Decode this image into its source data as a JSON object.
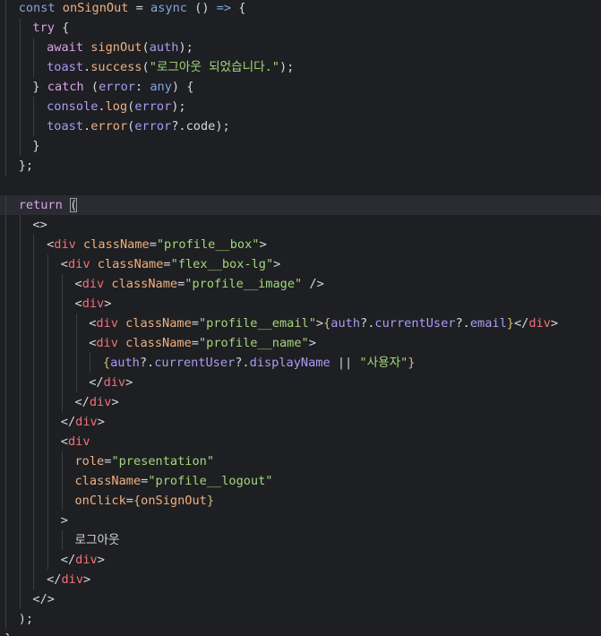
{
  "editor": {
    "language": "tsx",
    "theme_background": "#1e1f22",
    "lines": [
      {
        "indent": 1,
        "tokens": [
          [
            "kw",
            "const "
          ],
          [
            "fn",
            "onSignOut"
          ],
          [
            "pn",
            " = "
          ],
          [
            "kw",
            "async"
          ],
          [
            "pn",
            " () "
          ],
          [
            "kw",
            "=>"
          ],
          [
            "pn",
            " {"
          ]
        ]
      },
      {
        "indent": 2,
        "tokens": [
          [
            "ctl",
            "try"
          ],
          [
            "pn",
            " {"
          ]
        ]
      },
      {
        "indent": 3,
        "tokens": [
          [
            "ctl",
            "await "
          ],
          [
            "fn",
            "signOut"
          ],
          [
            "pn",
            "("
          ],
          [
            "var",
            "auth"
          ],
          [
            "pn",
            ");"
          ]
        ]
      },
      {
        "indent": 3,
        "tokens": [
          [
            "var",
            "toast"
          ],
          [
            "pn",
            "."
          ],
          [
            "fn",
            "success"
          ],
          [
            "pn",
            "("
          ],
          [
            "str",
            "\"로그아웃 되었습니다.\""
          ],
          [
            "pn",
            ");"
          ]
        ]
      },
      {
        "indent": 2,
        "tokens": [
          [
            "pn",
            "} "
          ],
          [
            "ctl",
            "catch"
          ],
          [
            "pn",
            " ("
          ],
          [
            "var",
            "error"
          ],
          [
            "pn",
            ": "
          ],
          [
            "kw",
            "any"
          ],
          [
            "pn",
            ") {"
          ]
        ]
      },
      {
        "indent": 3,
        "tokens": [
          [
            "var",
            "console"
          ],
          [
            "pn",
            "."
          ],
          [
            "fn",
            "log"
          ],
          [
            "pn",
            "("
          ],
          [
            "var",
            "error"
          ],
          [
            "pn",
            ");"
          ]
        ]
      },
      {
        "indent": 3,
        "tokens": [
          [
            "var",
            "toast"
          ],
          [
            "pn",
            "."
          ],
          [
            "fn",
            "error"
          ],
          [
            "pn",
            "("
          ],
          [
            "var",
            "error"
          ],
          [
            "pn",
            "?.code);"
          ]
        ]
      },
      {
        "indent": 2,
        "tokens": [
          [
            "pn",
            "}"
          ]
        ]
      },
      {
        "indent": 1,
        "tokens": [
          [
            "pn",
            "};"
          ]
        ]
      },
      {
        "indent": 0,
        "tokens": []
      },
      {
        "indent": 1,
        "current": true,
        "tokens": [
          [
            "ctl",
            "return "
          ],
          [
            "pn",
            "("
          ]
        ]
      },
      {
        "indent": 2,
        "tokens": [
          [
            "pn",
            "<>"
          ]
        ]
      },
      {
        "indent": 3,
        "tokens": [
          [
            "pn",
            "<"
          ],
          [
            "tag",
            "div"
          ],
          [
            "attr",
            " className"
          ],
          [
            "pn",
            "="
          ],
          [
            "str",
            "\"profile__box\""
          ],
          [
            "pn",
            ">"
          ]
        ]
      },
      {
        "indent": 4,
        "tokens": [
          [
            "pn",
            "<"
          ],
          [
            "tag",
            "div"
          ],
          [
            "attr",
            " className"
          ],
          [
            "pn",
            "="
          ],
          [
            "str",
            "\"flex__box-lg\""
          ],
          [
            "pn",
            ">"
          ]
        ]
      },
      {
        "indent": 5,
        "tokens": [
          [
            "pn",
            "<"
          ],
          [
            "tag",
            "div"
          ],
          [
            "attr",
            " className"
          ],
          [
            "pn",
            "="
          ],
          [
            "str",
            "\"profile__image\""
          ],
          [
            "pn",
            " />"
          ]
        ]
      },
      {
        "indent": 5,
        "tokens": [
          [
            "pn",
            "<"
          ],
          [
            "tag",
            "div"
          ],
          [
            "pn",
            ">"
          ]
        ]
      },
      {
        "indent": 6,
        "tokens": [
          [
            "pn",
            "<"
          ],
          [
            "tag",
            "div"
          ],
          [
            "attr",
            " className"
          ],
          [
            "pn",
            "="
          ],
          [
            "str",
            "\"profile__email\""
          ],
          [
            "pn",
            ">"
          ],
          [
            "brk",
            "{"
          ],
          [
            "var",
            "auth"
          ],
          [
            "pn",
            "?."
          ],
          [
            "var",
            "currentUser"
          ],
          [
            "pn",
            "?."
          ],
          [
            "var",
            "email"
          ],
          [
            "brk",
            "}"
          ],
          [
            "pn",
            "</"
          ],
          [
            "tag",
            "div"
          ],
          [
            "pn",
            ">"
          ]
        ]
      },
      {
        "indent": 6,
        "tokens": [
          [
            "pn",
            "<"
          ],
          [
            "tag",
            "div"
          ],
          [
            "attr",
            " className"
          ],
          [
            "pn",
            "="
          ],
          [
            "str",
            "\"profile__name\""
          ],
          [
            "pn",
            ">"
          ]
        ]
      },
      {
        "indent": 7,
        "tokens": [
          [
            "brk",
            "{"
          ],
          [
            "var",
            "auth"
          ],
          [
            "pn",
            "?."
          ],
          [
            "var",
            "currentUser"
          ],
          [
            "pn",
            "?."
          ],
          [
            "var",
            "displayName"
          ],
          [
            "pn",
            " || "
          ],
          [
            "str",
            "\"사용자\""
          ],
          [
            "brk",
            "}"
          ]
        ]
      },
      {
        "indent": 6,
        "tokens": [
          [
            "pn",
            "</"
          ],
          [
            "tag",
            "div"
          ],
          [
            "pn",
            ">"
          ]
        ]
      },
      {
        "indent": 5,
        "tokens": [
          [
            "pn",
            "</"
          ],
          [
            "tag",
            "div"
          ],
          [
            "pn",
            ">"
          ]
        ]
      },
      {
        "indent": 4,
        "tokens": [
          [
            "pn",
            "</"
          ],
          [
            "tag",
            "div"
          ],
          [
            "pn",
            ">"
          ]
        ]
      },
      {
        "indent": 4,
        "tokens": [
          [
            "pn",
            "<"
          ],
          [
            "tag",
            "div"
          ]
        ]
      },
      {
        "indent": 5,
        "tokens": [
          [
            "attr",
            "role"
          ],
          [
            "pn",
            "="
          ],
          [
            "str",
            "\"presentation\""
          ]
        ]
      },
      {
        "indent": 5,
        "tokens": [
          [
            "attr",
            "className"
          ],
          [
            "pn",
            "="
          ],
          [
            "str",
            "\"profile__logout\""
          ]
        ]
      },
      {
        "indent": 5,
        "tokens": [
          [
            "attr",
            "onClick"
          ],
          [
            "pn",
            "="
          ],
          [
            "brk",
            "{"
          ],
          [
            "fn",
            "onSignOut"
          ],
          [
            "brk",
            "}"
          ]
        ]
      },
      {
        "indent": 4,
        "tokens": [
          [
            "pn",
            ">"
          ]
        ]
      },
      {
        "indent": 5,
        "tokens": [
          [
            "txt",
            "로그아웃"
          ]
        ]
      },
      {
        "indent": 4,
        "tokens": [
          [
            "pn",
            "</"
          ],
          [
            "tag",
            "div"
          ],
          [
            "pn",
            ">"
          ]
        ]
      },
      {
        "indent": 3,
        "tokens": [
          [
            "pn",
            "</"
          ],
          [
            "tag",
            "div"
          ],
          [
            "pn",
            ">"
          ]
        ]
      },
      {
        "indent": 2,
        "tokens": [
          [
            "pn",
            "</>"
          ]
        ]
      },
      {
        "indent": 1,
        "tokens": [
          [
            "pn",
            ");"
          ]
        ]
      },
      {
        "indent": 0,
        "tokens": [
          [
            "pn",
            "}"
          ]
        ]
      }
    ]
  }
}
